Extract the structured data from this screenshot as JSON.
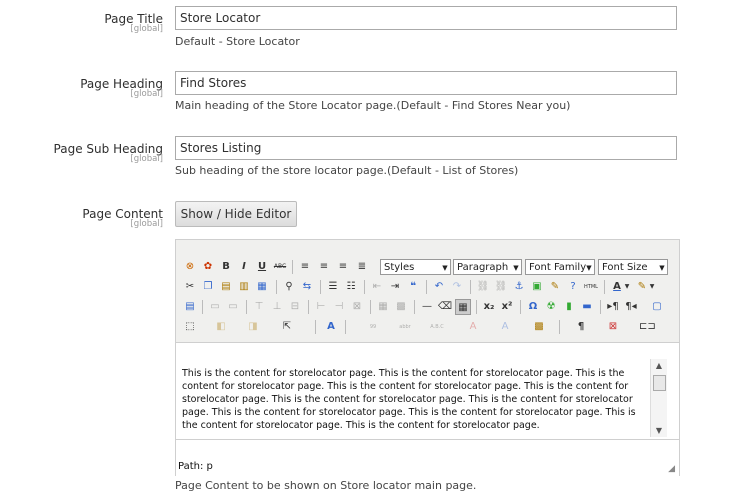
{
  "fields": {
    "title": {
      "label": "Page Title",
      "scope": "[global]",
      "value": "Store Locator",
      "note": "Default - Store Locator"
    },
    "heading": {
      "label": "Page Heading",
      "scope": "[global]",
      "value": "Find Stores",
      "note": "Main heading of the Store Locator page.(Default - Find Stores Near you)"
    },
    "subheading": {
      "label": "Page Sub Heading",
      "scope": "[global]",
      "value": "Stores Listing",
      "note": "Sub heading of the store locator page.(Default - List of Stores)"
    },
    "content": {
      "label": "Page Content",
      "scope": "[global]",
      "note": "Page Content to be shown on Store locator main page."
    }
  },
  "editor": {
    "toggle_label": "Show / Hide Editor",
    "selects": {
      "styles": "Styles",
      "format": "Paragraph",
      "font_family": "Font Family",
      "font_size": "Font Size"
    },
    "body_text": "This is the content for storelocator page.  This is the content for storelocator page.  This is the content for storelocator page.  This is the content for storelocator page.  This is the content for storelocator page.  This is the content for storelocator page.  This is the content for storelocator page.  This is the content for storelocator page.  This is the content for storelocator page.  This is the content for storelocator page.  This is the content for storelocator page.",
    "path": "Path: p",
    "buttons": {
      "bold": "B",
      "italic": "I",
      "underline": "U",
      "strike": "ABC",
      "omega": "Ω",
      "pilcrow": "¶"
    }
  }
}
